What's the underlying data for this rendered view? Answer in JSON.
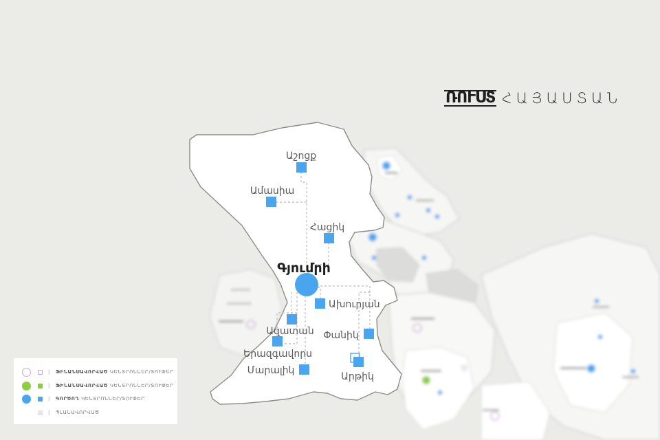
{
  "brand": {
    "logo_text": "ՌՈՒՍՏ",
    "country": "ՀԱՅԱՍՏԱՆ"
  },
  "region": {
    "labels": [
      {
        "id": "ashotsk",
        "text": "Աշոցք",
        "emphasis": false
      },
      {
        "id": "amasia",
        "text": "Ամասիա",
        "emphasis": false
      },
      {
        "id": "hatsik",
        "text": "Հացիկ",
        "emphasis": false
      },
      {
        "id": "gyumri",
        "text": "Գյումրի",
        "emphasis": true
      },
      {
        "id": "akhuryan",
        "text": "Ախուրյան",
        "emphasis": false
      },
      {
        "id": "azatan",
        "text": "Ազատան",
        "emphasis": false
      },
      {
        "id": "panik",
        "text": "Փանիկ",
        "emphasis": false
      },
      {
        "id": "yeraskhavan",
        "text": "Երազգավորս",
        "emphasis": false
      },
      {
        "id": "maralik",
        "text": "Մարալիկ",
        "emphasis": false
      },
      {
        "id": "artik",
        "text": "Արթիկ",
        "emphasis": false
      }
    ]
  },
  "legend": {
    "items": [
      {
        "symbol": "outline",
        "bold": "ՖԻՆԱՆՍԱՎՈՐՎԱԾ",
        "text": "ԿԵՆՏՐՈՆՆԵՐ/ՏՈՒՓԵՐ",
        "color": "#c9a8d8"
      },
      {
        "symbol": "filled",
        "bold": "ՖԻՆԱՆՍԱՎՈՐՎԱԾ",
        "text": "ԿԵՆՏՐՈՆՆԵՐ/ՏՈՒՓԵՐ",
        "color": "#8dcd3f"
      },
      {
        "symbol": "filled",
        "bold": "ԳՈՐԾՈՂ",
        "text": "ԿԵՆՏՐՈՆՆԵՐ/ՏՈՒՓԵՐ",
        "color": "#49a6ee"
      },
      {
        "symbol": "grey",
        "bold": "",
        "text": "ՊԼԱՆԱՎՈՐՎԱԾ",
        "color": "#e5e5e5"
      }
    ]
  },
  "colors": {
    "operating": "#49a6ee",
    "funded": "#8dcd3f",
    "planned_funded": "#c9a8d8",
    "region_fill": "#ffffff",
    "region_stroke": "#8c8c8c",
    "background": "#ebebe8"
  }
}
